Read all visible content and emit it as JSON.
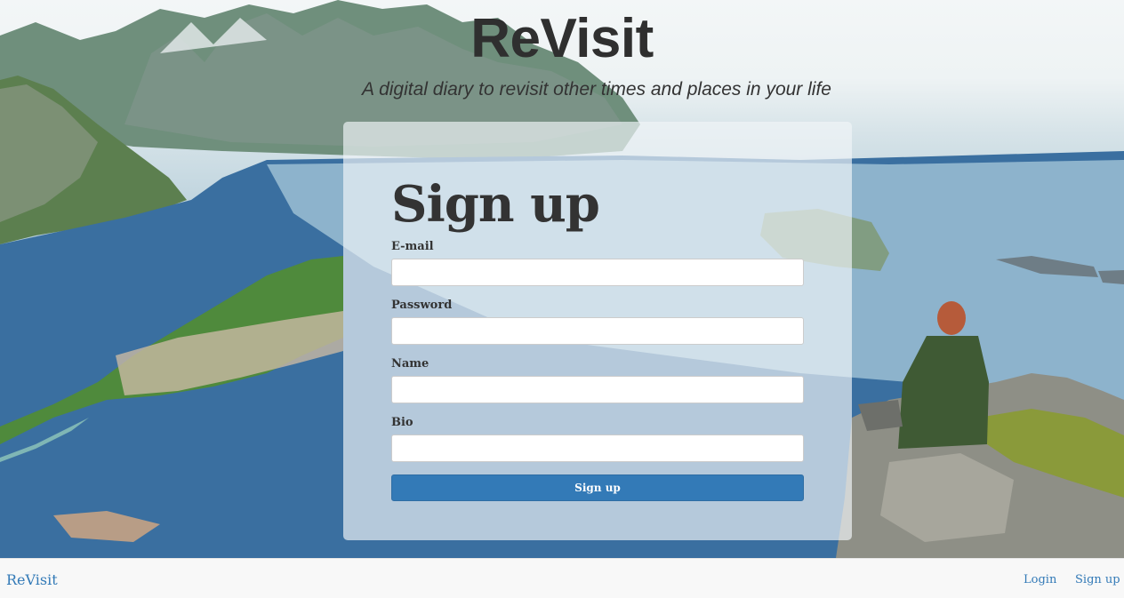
{
  "header": {
    "title": "ReVisit",
    "subtitle": "A digital diary to revisit other times and places in your life"
  },
  "form": {
    "title": "Sign up",
    "fields": [
      {
        "label": "E-mail",
        "value": "",
        "placeholder": ""
      },
      {
        "label": "Password",
        "value": "",
        "placeholder": ""
      },
      {
        "label": "Name",
        "value": "",
        "placeholder": ""
      },
      {
        "label": "Bio",
        "value": "",
        "placeholder": ""
      }
    ],
    "submit_label": "Sign up"
  },
  "navbar": {
    "brand": "ReVisit",
    "links": [
      "Login",
      "Sign up"
    ]
  },
  "colors": {
    "primary": "#337ab7",
    "title_text": "#2f2f2f",
    "navbar_bg": "#f8f8f8"
  }
}
